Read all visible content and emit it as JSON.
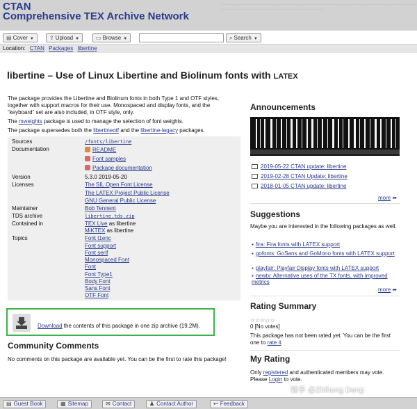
{
  "header": {
    "title_line1": "CTAN",
    "title_line2": "Comprehensive TEX Archive Network"
  },
  "navbar": {
    "cover": "Cover",
    "upload": "Upload",
    "browse": "Browse",
    "search_placeholder": "",
    "search": "Search"
  },
  "location": {
    "label": "Location:",
    "items": [
      "CTAN",
      "Packages",
      "libertine"
    ]
  },
  "page": {
    "title": "libertine – Use of Linux Libertine and Biolinum fonts with ",
    "title_latex": "LATEX"
  },
  "intro": {
    "p1": "The package provides the Libertine and Biolinum fonts in both Type 1 and OTF styles, together with support macros for their use. Monospaced and display fonts, and the “keyboard” set are also included, in OTF style, only.",
    "p2_link": "mweights",
    "p2_text": " package is used to manage the selection of font weights.",
    "p2_prefix": "The ",
    "p3_prefix": "The package supersedes both the ",
    "p3_link1": "libertineotf",
    "p3_mid": " and the ",
    "p3_link2": "libertine-legacy",
    "p3_suffix": " packages."
  },
  "info": {
    "sources_label": "Sources",
    "sources": "/fonts/libertine",
    "documentation_label": "Documentation",
    "doc_readme": "README",
    "doc_samples": "Font samples",
    "doc_package": "Package documentation",
    "version_label": "Version",
    "version": "5.3.0 2019-05-20",
    "licenses_label": "Licenses",
    "license1": "The SIL Open Font License",
    "license2": "The LATEX Project Public License",
    "license3": "GNU General Public License",
    "maintainer_label": "Maintainer",
    "maintainer": "Bob Tennent",
    "tds_label": "TDS archive",
    "tds": "libertine.tds.zip",
    "contained_label": "Contained in",
    "contained1_link": "TEX Live",
    "contained1_text": " as libertine",
    "contained2_link": "MiKTEX",
    "contained2_text": " as libertine",
    "topics_label": "Topics",
    "topics": [
      "Font t1enc",
      "Font support",
      "Font serif",
      "Monospaced Font",
      "Font",
      "Font Type1",
      "Body Font",
      "Sans Font",
      "OTF Font"
    ]
  },
  "download": {
    "link": "Download",
    "text": " the contents of this package in one zip archive (19.2M)."
  },
  "community": {
    "title": "Community Comments",
    "text": "No comments on this package are available yet. You can be the first to rate this package!"
  },
  "announcements": {
    "title": "Announcements",
    "items": [
      "2019-05-22 CTAN update: libertine",
      "2019-02-28 CTAN Update: libertine",
      "2018-01-05 CTAN update: libertine"
    ],
    "more": "more"
  },
  "suggestions": {
    "title": "Suggestions",
    "intro": "Maybe you are interested in the following packages as well.",
    "items": [
      "fira: Fira fonts with LATEX support",
      "gofonts: GoSans and GoMono fonts with LATEX support",
      "playfair: Playfair Display fonts with LATEX support",
      "newtx: Alternative uses of the TX fonts, with improved metrics"
    ],
    "more": "more"
  },
  "rating": {
    "title": "Rating Summary",
    "stars": "☆☆☆☆☆",
    "votes": "0 [No votes]",
    "text_prefix": "This package has not been rated yet. You can be the first one to ",
    "link": "rate it",
    "text_suffix": "."
  },
  "myrating": {
    "title": "My Rating",
    "link1": "registered",
    "text1_prefix": "Only ",
    "text1_suffix": " and authenticated members may vote.",
    "text2_prefix": "Please ",
    "link2": "Login",
    "text2_suffix": " to vote."
  },
  "footer": {
    "guestbook": "Guest Book",
    "sitemap": "Sitemap",
    "contact": "Contact",
    "contact_author": "Contact Author",
    "feedback": "Feedback"
  },
  "watermark": "知乎 @Zhihong Deng"
}
